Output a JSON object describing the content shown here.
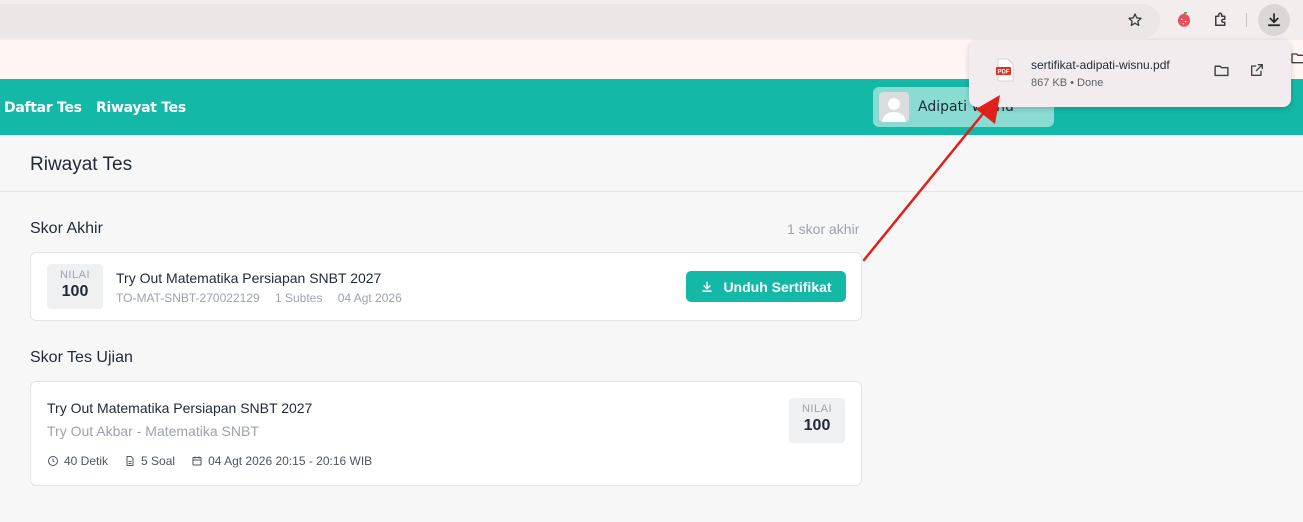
{
  "browser": {
    "icons": [
      "star-icon",
      "fruit-extension-icon",
      "puzzle-extension-icon",
      "download-icon",
      "folder-icon"
    ]
  },
  "download_popup": {
    "filename": "sertifikat-adipati-wisnu.pdf",
    "status": "867 KB • Done",
    "file_icon_label": "PDF",
    "icons": [
      "pdf-file-icon",
      "open-folder-icon",
      "open-external-icon"
    ]
  },
  "header": {
    "nav": [
      "Daftar Tes",
      "Riwayat Tes"
    ],
    "user_name": "Adipati Wisnu",
    "accent": "#14b8a6"
  },
  "page": {
    "title": "Riwayat Tes"
  },
  "final_scores": {
    "title": "Skor Akhir",
    "count": "1 skor akhir",
    "item": {
      "score_label": "NILAI",
      "score": "100",
      "name": "Try Out Matematika Persiapan SNBT 2027",
      "code": "TO-MAT-SNBT-270022129",
      "subtests": "1 Subtes",
      "date": "04 Agt 2026",
      "button": "Unduh Sertifikat"
    }
  },
  "exam_scores": {
    "title": "Skor Tes Ujian",
    "item": {
      "name": "Try Out Matematika Persiapan SNBT 2027",
      "subtitle": "Try Out Akbar - Matematika SNBT",
      "duration": "40 Detik",
      "questions": "5 Soal",
      "datetime": "04 Agt 2026 20:15 - 20:16 WIB",
      "score_label": "NILAI",
      "score": "100"
    }
  },
  "annotation": {
    "color": "#e0201b"
  }
}
